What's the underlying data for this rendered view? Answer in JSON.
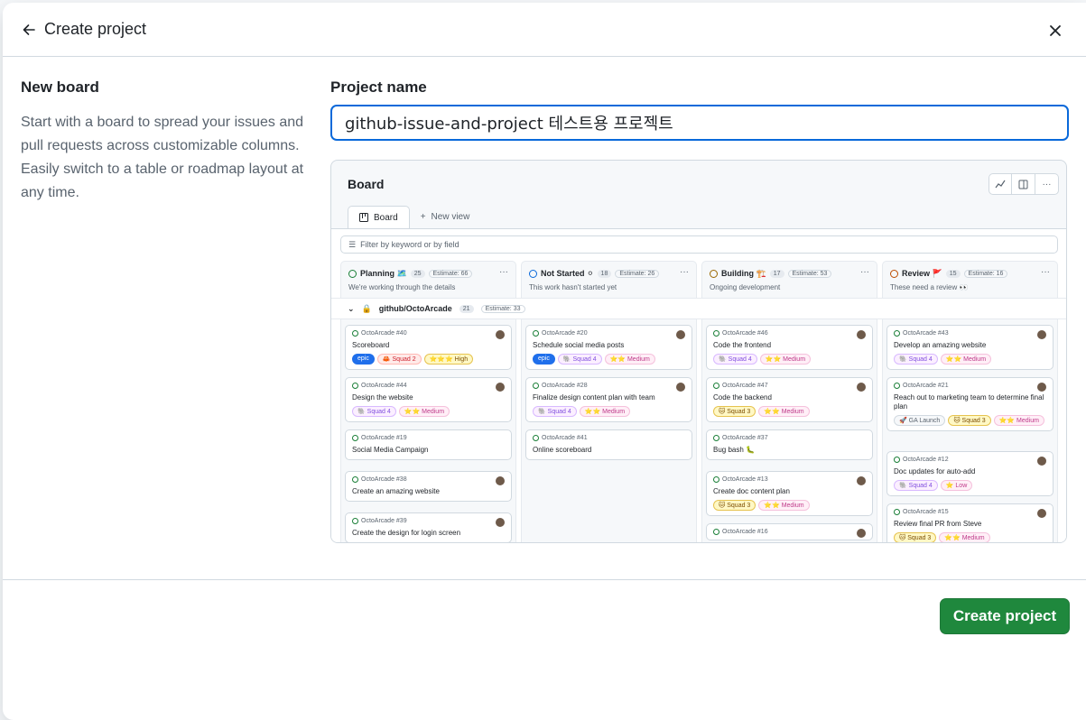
{
  "dialog": {
    "title": "Create project",
    "template_title": "New board",
    "template_description": "Start with a board to spread your issues and pull requests across customizable columns. Easily switch to a table or roadmap layout at any time.",
    "project_name_label": "Project name",
    "project_name_value": "github-issue-and-project 테스트용 프로젝트",
    "create_button": "Create project"
  },
  "preview": {
    "title": "Board",
    "tabs": [
      "Board",
      "New view"
    ],
    "filter_placeholder": "Filter by keyword or by field",
    "group": {
      "name": "github/OctoArcade",
      "count": "21",
      "estimate": "Estimate: 33"
    },
    "columns": [
      {
        "name": "Planning 🗺️",
        "count": "25",
        "estimate": "Estimate: 66",
        "desc": "We're working through the details",
        "color": "#1a7f37"
      },
      {
        "name": "Not Started ⚪",
        "count": "18",
        "estimate": "Estimate: 26",
        "desc": "This work hasn't started yet",
        "color": "#0969da"
      },
      {
        "name": "Building 🏗️",
        "count": "17",
        "estimate": "Estimate: 53",
        "desc": "Ongoing development",
        "color": "#9a6700"
      },
      {
        "name": "Review 🚩",
        "count": "15",
        "estimate": "Estimate: 16",
        "desc": "These need a review 👀",
        "color": "#bc4c00"
      }
    ],
    "cards": [
      [
        {
          "id": "OctoArcade #40",
          "title": "Scoreboard",
          "labels": [
            "epic",
            "🦀 Squad 2",
            "⭐⭐⭐ High"
          ]
        },
        {
          "id": "OctoArcade #44",
          "title": "Design the website",
          "labels": [
            "🐘 Squad 4",
            "⭐⭐ Medium"
          ]
        },
        {
          "id": "OctoArcade #19",
          "title": "Social Media Campaign",
          "labels": []
        },
        {
          "id": "OctoArcade #38",
          "title": "Create an amazing website",
          "labels": []
        },
        {
          "id": "OctoArcade #39",
          "title": "Create the design for login screen",
          "labels": []
        }
      ],
      [
        {
          "id": "OctoArcade #20",
          "title": "Schedule social media posts",
          "labels": [
            "epic",
            "🐘 Squad 4",
            "⭐⭐ Medium"
          ]
        },
        {
          "id": "OctoArcade #28",
          "title": "Finalize design content plan with team",
          "labels": [
            "🐘 Squad 4",
            "⭐⭐ Medium"
          ]
        },
        {
          "id": "OctoArcade #41",
          "title": "Online scoreboard",
          "labels": []
        }
      ],
      [
        {
          "id": "OctoArcade #46",
          "title": "Code the frontend",
          "labels": [
            "🐘 Squad 4",
            "⭐⭐ Medium"
          ]
        },
        {
          "id": "OctoArcade #47",
          "title": "Code the backend",
          "labels": [
            "🐱 Squad 3",
            "⭐⭐ Medium"
          ]
        },
        {
          "id": "OctoArcade #37",
          "title": "Bug bash 🐛",
          "labels": []
        },
        {
          "id": "OctoArcade #13",
          "title": "Create doc content plan",
          "labels": [
            "🐱 Squad 3",
            "⭐⭐ Medium"
          ]
        },
        {
          "id": "OctoArcade #16",
          "title": "",
          "labels": []
        }
      ],
      [
        {
          "id": "OctoArcade #43",
          "title": "Develop an amazing website",
          "labels": [
            "🐘 Squad 4",
            "⭐⭐ Medium"
          ]
        },
        {
          "id": "OctoArcade #21",
          "title": "Reach out to marketing team to determine final plan",
          "labels": [
            "🚀 GA Launch",
            "🐱 Squad 3",
            "⭐⭐ Medium"
          ]
        },
        {
          "id": "OctoArcade #12",
          "title": "Doc updates for auto-add",
          "labels": [
            "🐘 Squad 4",
            "⭐ Low"
          ]
        },
        {
          "id": "OctoArcade #15",
          "title": "Review final PR from Steve",
          "labels": [
            "🐱 Squad 3",
            "⭐⭐ Medium"
          ]
        }
      ]
    ]
  },
  "colors": {
    "accent": "#0969da",
    "primary_button": "#1f883d"
  }
}
